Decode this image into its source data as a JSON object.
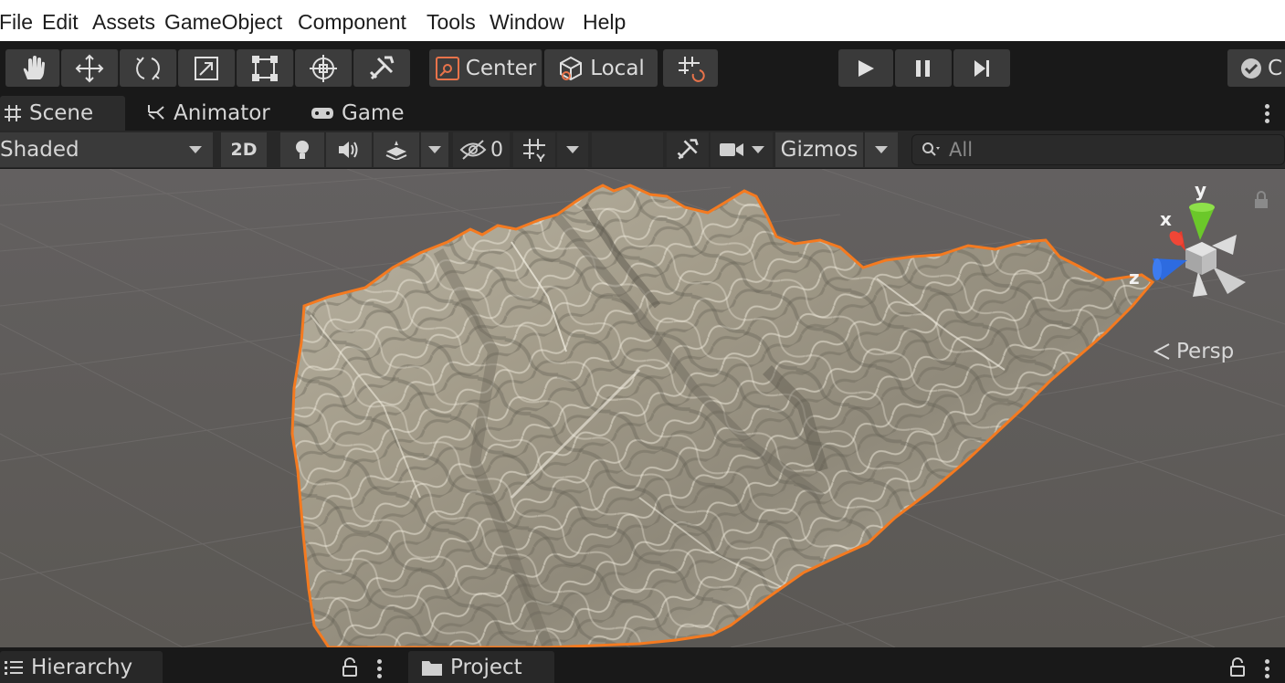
{
  "menu": [
    "File",
    "Edit",
    "Assets",
    "GameObject",
    "Component",
    "Tools",
    "Window",
    "Help"
  ],
  "toolbar": {
    "tools": [
      "hand-tool",
      "move-tool",
      "rotate-tool",
      "scale-tool",
      "rect-tool",
      "transform-tool",
      "custom-editor-tool"
    ],
    "pivot_mode_label": "Center",
    "pivot_rotation_label": "Local",
    "account_initial": "C"
  },
  "tabs": {
    "scene": "Scene",
    "animator": "Animator",
    "game": "Game"
  },
  "scene_toolbar": {
    "draw_mode": "Shaded",
    "two_d_label": "2D",
    "hidden_count": "0",
    "gizmos_label": "Gizmos",
    "search_placeholder": "All"
  },
  "viewport": {
    "projection_label": "Persp",
    "gizmo_axes": {
      "x": "x",
      "y": "y",
      "z": "z"
    },
    "selection_outline_color": "#f47a20",
    "background_color": "#5d5a57"
  },
  "bottom_tabs": {
    "hierarchy": "Hierarchy",
    "project": "Project"
  }
}
